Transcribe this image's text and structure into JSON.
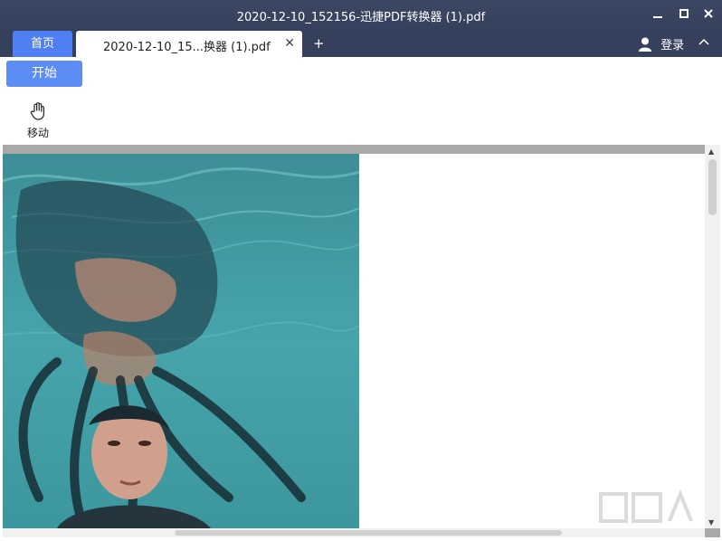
{
  "window": {
    "title": "2020-12-10_152156-迅捷PDF转换器 (1).pdf",
    "minimize_icon": "minimize-icon",
    "maximize_icon": "maximize-icon",
    "close_icon": "close-icon"
  },
  "tabs": {
    "home_label": "首页",
    "doc_label": "2020-12-10_15...换器 (1).pdf",
    "close_glyph": "✕",
    "add_glyph": "+"
  },
  "account": {
    "login_label": "登录",
    "icon": "user-icon"
  },
  "ribbon": {
    "start_label": "开始",
    "move_label": "移动",
    "move_icon": "hand-icon"
  },
  "colors": {
    "titlebar": "#35415c",
    "accent": "#4f7ff2",
    "start_button": "#5b8df5"
  }
}
